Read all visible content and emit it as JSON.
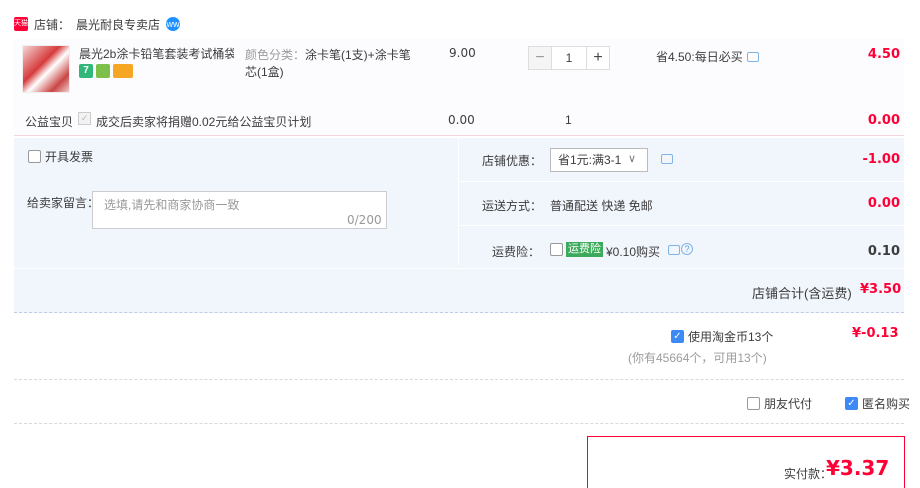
{
  "shop": {
    "badge": "天猫",
    "label": "店铺：",
    "name": "晨光耐良专卖店",
    "wangwang": "ww"
  },
  "item": {
    "title": "晨光2b涂卡铅笔套装考试桶袋...",
    "badge_7": "7",
    "sku_label": "颜色分类：",
    "sku_value": "涂卡笔(1支)+涂卡笔芯(1盒)",
    "unit_price": "9.00",
    "qty_minus": "−",
    "qty_value": "1",
    "qty_plus": "+",
    "promo": "省4.50:每日必买",
    "subtotal": "4.50"
  },
  "charity": {
    "label": "公益宝贝",
    "text": "成交后卖家将捐赠0.02元给公益宝贝计划",
    "price": "0.00",
    "qty": "1",
    "subtotal": "0.00"
  },
  "options": {
    "invoice_label": "开具发票",
    "message_label": "给卖家留言：",
    "message_placeholder": "选填,请先和商家协商一致",
    "message_count": "0/200",
    "coupon_label": "店铺优惠：",
    "coupon_value": "省1元:满3-1",
    "coupon_amount": "-1.00",
    "shipping_label": "运送方式：",
    "shipping_value": "普通配送 快递 免邮",
    "shipping_amount": "0.00",
    "insurance_label": "运费险：",
    "insurance_tag": "运费险",
    "insurance_text": "¥0.10购买",
    "insurance_amount": "0.10"
  },
  "shop_total": {
    "label": "店铺合计(含运费)",
    "value": "¥3.50"
  },
  "coins": {
    "label": "使用淘金币13个",
    "sub": "(你有45664个，可用13个)",
    "value": "¥-0.13"
  },
  "purchase": {
    "friend_pay": "朋友代付",
    "anonymous": "匿名购买"
  },
  "final": {
    "label": "实付款：",
    "value": "¥3.37"
  },
  "colors": {
    "accent": "#ff0036",
    "panel": "#f1f5fc",
    "check": "#3d89f5"
  }
}
